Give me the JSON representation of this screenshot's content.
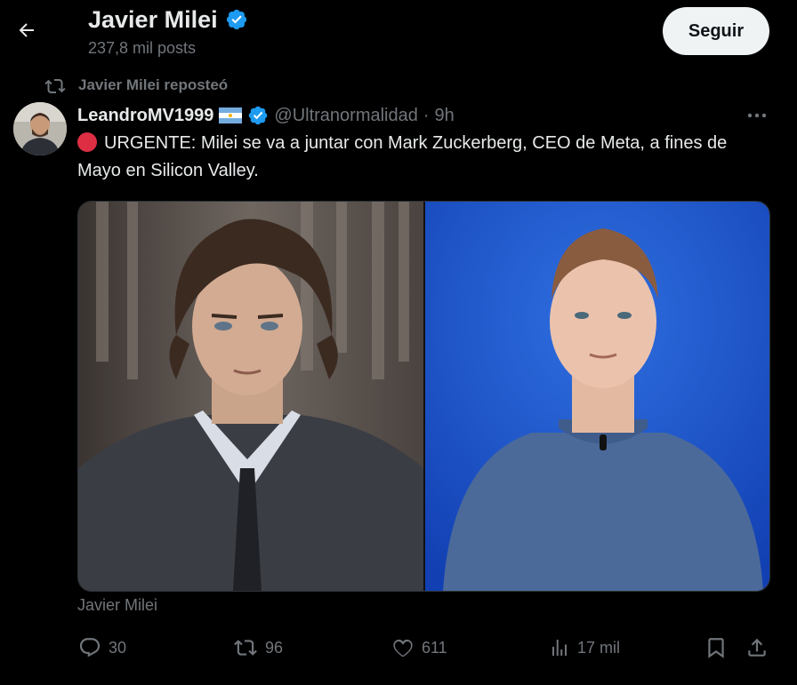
{
  "header": {
    "title": "Javier Milei",
    "posts_count": "237,8 mil posts",
    "follow_label": "Seguir"
  },
  "repost": {
    "label": "Javier Milei reposteó"
  },
  "tweet": {
    "display_name": "LeandroMV1999",
    "handle": "@Ultranormalidad",
    "separator": "·",
    "time": "9h",
    "text": "URGENTE: Milei se va a juntar con Mark Zuckerberg, CEO de Meta, a fines de Mayo en Silicon Valley.",
    "media_caption": "Javier Milei"
  },
  "actions": {
    "replies": "30",
    "reposts": "96",
    "likes": "611",
    "views": "17 mil"
  },
  "colors": {
    "background": "#000000",
    "text": "#e7e9ea",
    "muted": "#71767b",
    "verified": "#1d9bf0",
    "follow_bg": "#eff3f4"
  },
  "icons": {
    "back": "arrow-left-icon",
    "verified": "verified-badge-icon",
    "repost": "repost-icon",
    "flag": "argentina-flag-icon",
    "more": "more-horizontal-icon",
    "reply": "reply-icon",
    "like": "heart-icon",
    "views": "analytics-icon",
    "bookmark": "bookmark-icon",
    "share": "share-icon"
  }
}
